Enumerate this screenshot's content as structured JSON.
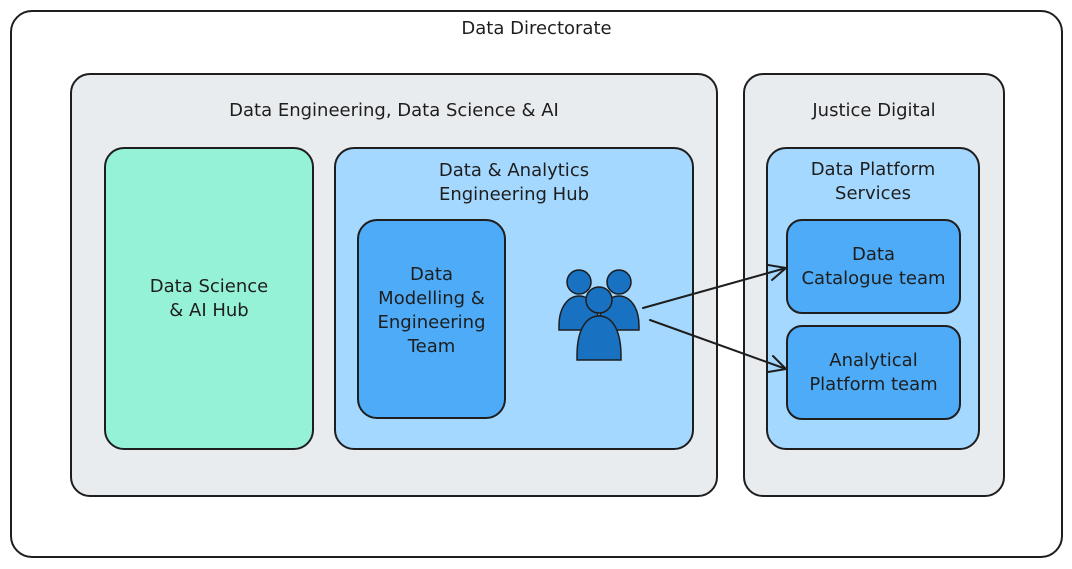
{
  "diagram": {
    "outer_title": "Data Directorate",
    "group_a_title": "Data Engineering, Data Science & AI",
    "group_b_title": "Justice Digital",
    "ds_hub_label": "Data Science\n& AI Hub",
    "da_hub_label": "Data & Analytics\nEngineering Hub",
    "dm_team_label": "Data\nModelling &\nEngineering\nTeam",
    "dps_label": "Data Platform\nServices",
    "catalogue_team_label": "Data\nCatalogue team",
    "analytical_team_label": "Analytical\nPlatform team",
    "people_icon": "users-group-icon"
  },
  "colors": {
    "outer_fill": "#ffffff",
    "group_fill": "#e9ecef",
    "ds_hub_fill": "#96f2d7",
    "hub_fill": "#a5d8ff",
    "team_fill": "#4dabf7",
    "people_fill": "#1971c2",
    "stroke": "#1e1e1e"
  }
}
